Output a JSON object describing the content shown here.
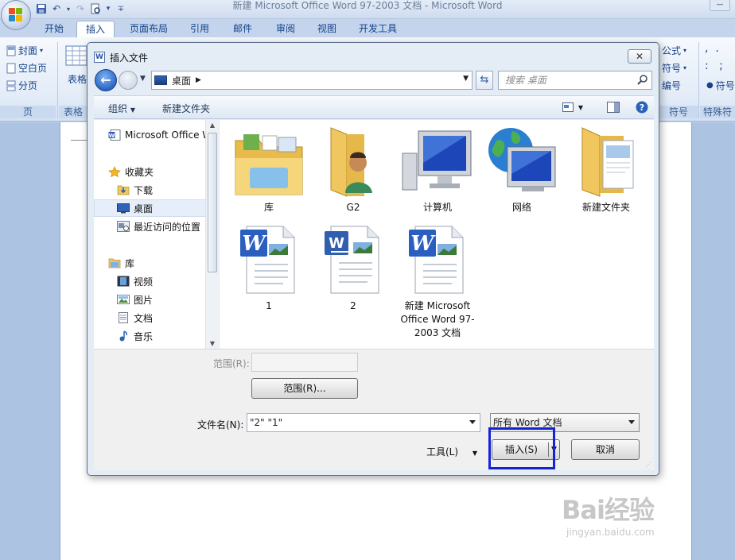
{
  "word": {
    "title": "新建 Microsoft Office Word 97-2003 文档 - Microsoft Word",
    "tabs": [
      {
        "label": "开始",
        "active": false
      },
      {
        "label": "插入",
        "active": true
      },
      {
        "label": "页面布局",
        "active": false
      },
      {
        "label": "引用",
        "active": false
      },
      {
        "label": "邮件",
        "active": false
      },
      {
        "label": "审阅",
        "active": false
      },
      {
        "label": "视图",
        "active": false
      },
      {
        "label": "开发工具",
        "active": false
      }
    ],
    "ribbon": {
      "pages_items": [
        "封面",
        "空白页",
        "分页"
      ],
      "pages_group": "页",
      "table_label": "表格",
      "table_group": "表格",
      "symbols_items": [
        "公式",
        "符号",
        "编号"
      ],
      "symbols_group": "符号",
      "special_item": "符号",
      "special_group": "特殊符"
    }
  },
  "dialog": {
    "title": "插入文件",
    "address": "桌面",
    "search_placeholder": "搜索 桌面",
    "toolbar": {
      "organize": "组织",
      "new_folder": "新建文件夹"
    },
    "nav": [
      {
        "label": "Microsoft Office Word",
        "icon": "word-doc-icon",
        "selected": false
      },
      {
        "label": "收藏夹",
        "icon": "star-icon",
        "selected": false
      },
      {
        "label": "下载",
        "icon": "downloads-icon",
        "selected": false
      },
      {
        "label": "桌面",
        "icon": "desktop-icon",
        "selected": true
      },
      {
        "label": "最近访问的位置",
        "icon": "recent-places-icon",
        "selected": false
      },
      {
        "label": "库",
        "icon": "libraries-icon",
        "selected": false
      },
      {
        "label": "视频",
        "icon": "video-icon",
        "selected": false
      },
      {
        "label": "图片",
        "icon": "pictures-icon",
        "selected": false
      },
      {
        "label": "文档",
        "icon": "documents-icon",
        "selected": false
      },
      {
        "label": "音乐",
        "icon": "music-icon",
        "selected": false
      }
    ],
    "files": [
      {
        "label": "库",
        "icon": "library-folder-icon"
      },
      {
        "label": "G2",
        "icon": "user-folder-icon"
      },
      {
        "label": "计算机",
        "icon": "computer-icon"
      },
      {
        "label": "网络",
        "icon": "network-icon"
      },
      {
        "label": "新建文件夹",
        "icon": "folder-icon"
      },
      {
        "label": "1",
        "icon": "word-file-icon"
      },
      {
        "label": "2",
        "icon": "word-doc-file-icon"
      },
      {
        "label": "新建 Microsoft Office Word 97-2003 文档",
        "icon": "word-file-icon"
      }
    ],
    "range_label": "范围(R):",
    "range_value": "",
    "range_button": "范围(R)...",
    "filename_label": "文件名(N):",
    "filename_value": "\"2\" \"1\"",
    "filetype_value": "所有 Word 文档",
    "tools_label": "工具(L)",
    "insert_button": "插入(S)",
    "cancel_button": "取消"
  },
  "watermark": {
    "brand": "Bai经验",
    "url": "jingyan.baidu.com"
  },
  "colors": {
    "highlight": "#1424d2",
    "ribbon_text": "#15428b"
  }
}
